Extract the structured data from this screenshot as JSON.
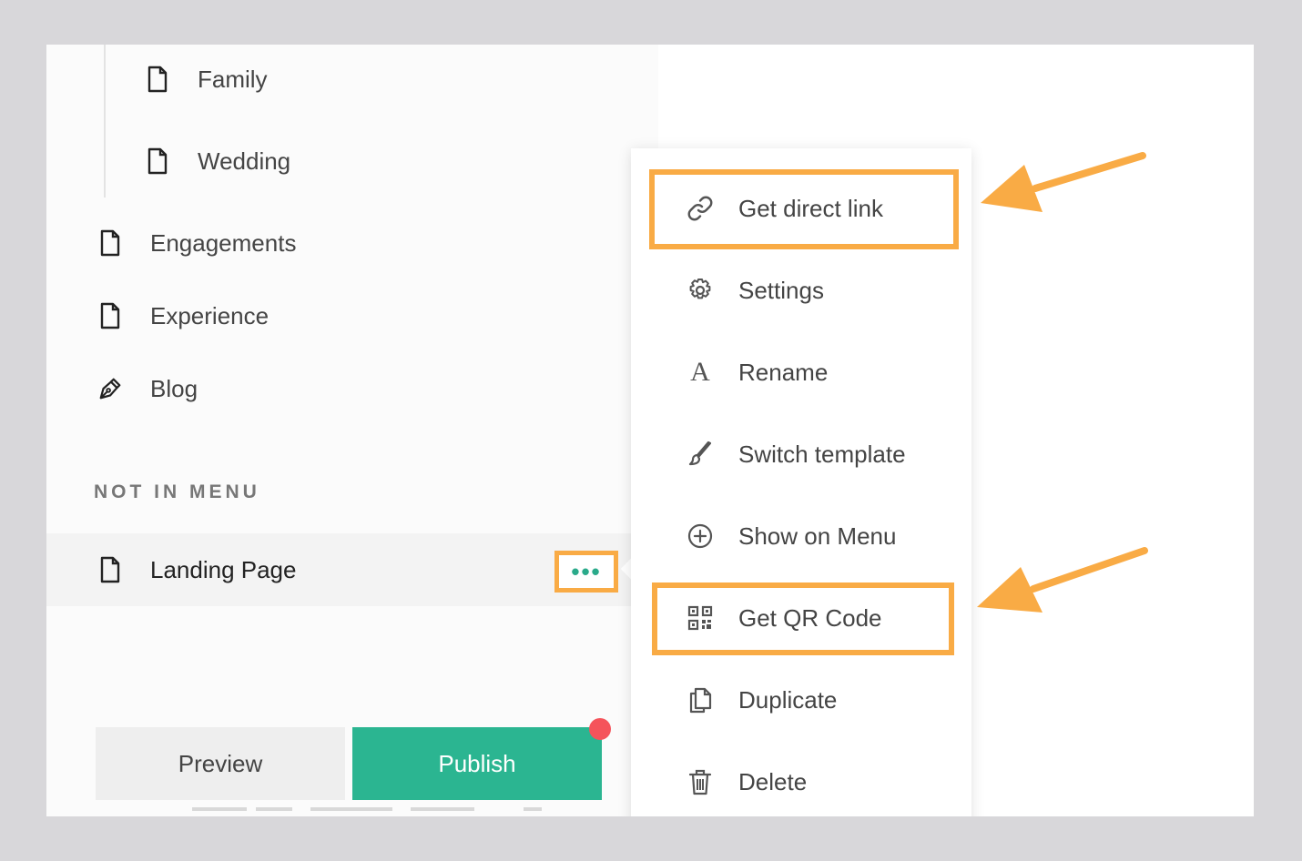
{
  "sidebar": {
    "items": [
      {
        "label": "Family",
        "icon": "page-icon"
      },
      {
        "label": "Wedding",
        "icon": "page-icon"
      },
      {
        "label": "Engagements",
        "icon": "page-icon"
      },
      {
        "label": "Experience",
        "icon": "page-icon"
      },
      {
        "label": "Blog",
        "icon": "pen-icon"
      }
    ],
    "section_label": "NOT IN MENU",
    "selected_item": {
      "label": "Landing Page",
      "icon": "page-icon",
      "more_label": "•••"
    }
  },
  "footer": {
    "preview_label": "Preview",
    "publish_label": "Publish"
  },
  "context_menu": {
    "items": [
      {
        "label": "Get direct link",
        "icon": "link-icon"
      },
      {
        "label": "Settings",
        "icon": "gear-icon"
      },
      {
        "label": "Rename",
        "icon": "rename-icon",
        "glyph": "A"
      },
      {
        "label": "Switch template",
        "icon": "brush-icon"
      },
      {
        "label": "Show on Menu",
        "icon": "plus-circle-icon"
      },
      {
        "label": "Get QR Code",
        "icon": "qr-code-icon"
      },
      {
        "label": "Duplicate",
        "icon": "duplicate-icon"
      },
      {
        "label": "Delete",
        "icon": "trash-icon"
      }
    ]
  },
  "colors": {
    "accent_green": "#2bb591",
    "highlight_orange": "#f9ab45",
    "notification_red": "#f5535b"
  }
}
